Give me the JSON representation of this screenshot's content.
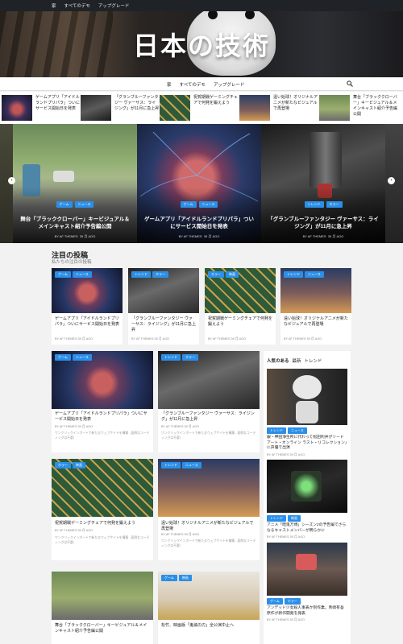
{
  "topbar": {
    "items": [
      "家",
      "すべてのデモ",
      "アップグレード"
    ]
  },
  "site": {
    "title": "日本の技術"
  },
  "mainnav": {
    "items": [
      "家",
      "すべてのデモ",
      "アップグレード"
    ]
  },
  "ticker": [
    {
      "title": "ゲームアプリ「アイドルランドプリパラ」ついにサービス開始日を発表"
    },
    {
      "title": "「グランブルーファンタジー ヴァーサス：ライジング」が11月に急上昇"
    },
    {
      "title": "祝賀期戦ゲーミングチェアで何発を鍛えよう"
    },
    {
      "title": "遠い始球！オリジナルアニメが新たなビジュアルで再登場"
    },
    {
      "title": "舞台「ブラッククローバー」キービジュアル＆メインキャスト紹介予告編公開"
    }
  ],
  "slider": [
    {
      "tags": [
        "ゲーム",
        "ニュース"
      ],
      "title": "舞台「ブラッククローバー」キービジュアル＆メインキャスト紹介予告編公開",
      "author": "BY AF THEMES",
      "date": "39 月 AGO"
    },
    {
      "tags": [
        "ゲーム",
        "ニュース"
      ],
      "title": "ゲームアプリ「アイドルランドプリパラ」ついにサービス開始日を発表",
      "author": "BY AF THEMES",
      "date": "39 月 AGO"
    },
    {
      "tags": [
        "トレンド",
        "ホラー"
      ],
      "title": "「グランブルーファンタジー ヴァーサス：ライジング」が11月に急上昇",
      "author": "BY AF THEMES",
      "date": "39 月 AGO"
    }
  ],
  "featured": {
    "title": "注目の投稿",
    "subtitle": "私たちの注目の投稿",
    "cards": [
      {
        "tags": [
          "ゲーム",
          "ニュース"
        ],
        "title": "ゲームアプリ「アイドルランドプリパラ」ついにサービス開始日を発表",
        "meta": "BY AF THEMES  39 月 AGO"
      },
      {
        "tags": [
          "トレンド",
          "ホラー"
        ],
        "title": "「グランブルーファンタジー ヴァーサス：ライジング」が11月に急上昇",
        "meta": "BY AF THEMES  39 月 AGO"
      },
      {
        "tags": [
          "ホラー",
          "映画"
        ],
        "title": "祝賀期戦ゲーミングチェアで何発を鍛えよう",
        "meta": "BY AF THEMES  39 月 AGO"
      },
      {
        "tags": [
          "トレンド",
          "ニュース"
        ],
        "title": "遠い始球！オリジナルアニメが新たなビジュアルで再登場",
        "meta": "BY AF THEMES  39 月 AGO"
      }
    ]
  },
  "grid": [
    {
      "tags": [
        "ゲーム",
        "ニュース"
      ],
      "title": "ゲームアプリ「アイドルランドプリパラ」ついにサービス開始日を発表",
      "meta": "BY AF THEMES  39 月 AGO",
      "excerpt": "ワンクリックインポートで新たなウェブサイトを構築 - 面倒なコーディングは不要!"
    },
    {
      "tags": [
        "トレンド",
        "ホラー"
      ],
      "title": "「グランブルーファンタジー ヴァーサス：ライジング」が11月に急上昇",
      "meta": "BY AF THEMES  39 月 AGO",
      "excerpt": "ワンクリックインポートで新たなウェブサイトを構築 - 面倒なコーディングは不要!"
    },
    {
      "tags": [
        "ホラー",
        "映画"
      ],
      "title": "祝賀期戦ゲーミングチェアで何発を鍛えよう",
      "meta": "BY AF THEMES  39 月 AGO",
      "excerpt": "ワンクリックインポートで新たなウェブサイトを構築 - 面倒なコーディングは不要!"
    },
    {
      "tags": [
        "トレンド",
        "ニュース"
      ],
      "title": "遠い始球！オリジナルアニメが新たなビジュアルで再登場",
      "meta": "BY AF THEMES  39 月 AGO",
      "excerpt": "ワンクリックインポートで新たなウェブサイトを構築 - 面倒なコーディングは不要!"
    },
    {
      "tags": [],
      "title": "舞台「ブラッククローバー」キービジュアル＆メインキャスト紹介予告編公開",
      "meta": "",
      "excerpt": ""
    },
    {
      "tags": [
        "ゲーム",
        "映画"
      ],
      "title": "松竹、映画版「鬼滅の刃」全公演中止へ",
      "meta": "",
      "excerpt": ""
    }
  ],
  "sidebar": {
    "tabs": [
      "人気のある",
      "最新",
      "トレンド"
    ],
    "items": [
      {
        "tags": [
          "トレンド",
          "ニュース"
        ],
        "title": "銀・神田浄生所に代わって松田利井がソードアート・オンライン ラスト・リコレクション」に声優で出演",
        "meta": "BY AF THEMES  39 月 AGO"
      },
      {
        "tags": [
          "トレンド",
          "映画"
        ],
        "title": "アニメ「暗鬼万博」シーズン2の予告編でさらなるキャストメンバーが明らかに",
        "meta": "BY AF THEMES  39 月 AGO"
      },
      {
        "tags": [
          "ゲーム",
          "ホラー"
        ],
        "title": "アンデッド少女殺人事表か別作業。青崎有吾原作が新作開発を発表",
        "meta": "BY AF THEMES  39 月 AGO"
      }
    ]
  },
  "colors": {
    "accent": "#2b8fe8",
    "topbar": "#1f2328"
  }
}
